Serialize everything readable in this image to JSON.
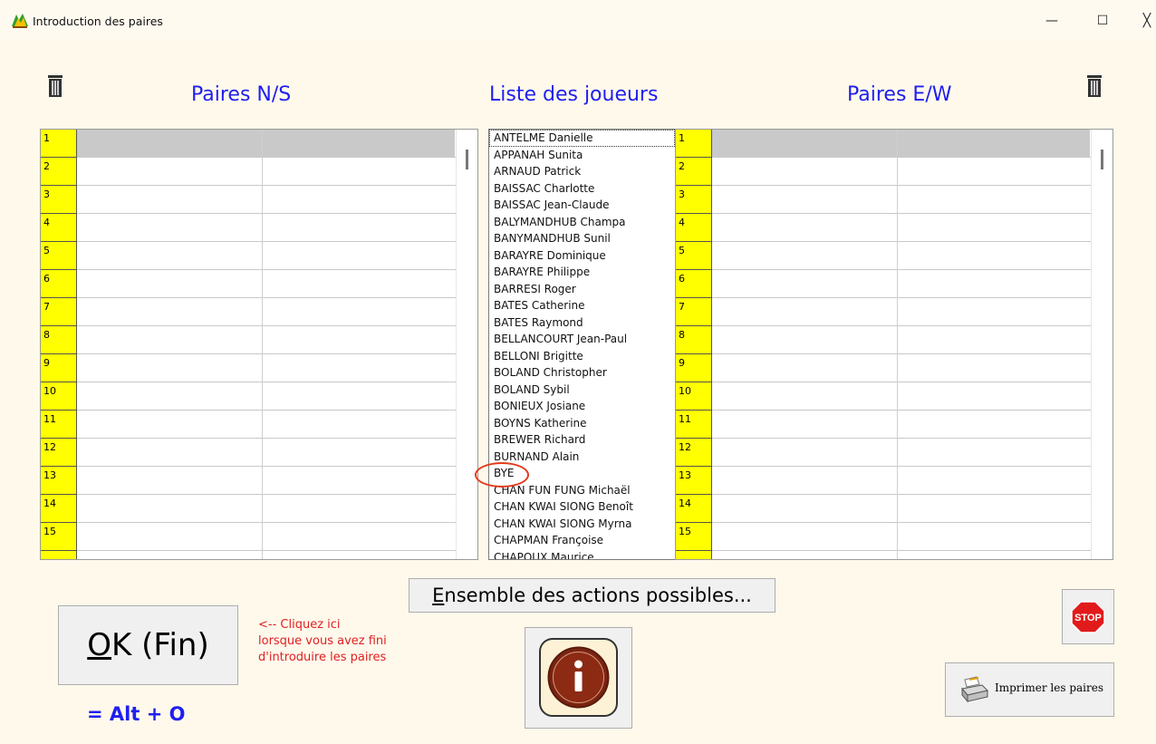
{
  "window": {
    "title": "Introduction des paires",
    "minimize": "—",
    "maximize": "☐",
    "close": "╳"
  },
  "headings": {
    "ns": "Paires N/S",
    "players": "Liste des joueurs",
    "ew": "Paires E/W"
  },
  "pairs_ns": [
    "1",
    "2",
    "3",
    "4",
    "5",
    "6",
    "7",
    "8",
    "9",
    "10",
    "11",
    "12",
    "13",
    "14",
    "15"
  ],
  "pairs_ew": [
    "1",
    "2",
    "3",
    "4",
    "5",
    "6",
    "7",
    "8",
    "9",
    "10",
    "11",
    "12",
    "13",
    "14",
    "15"
  ],
  "players": [
    "ANTELME Danielle",
    "APPANAH Sunita",
    "ARNAUD Patrick",
    "BAISSAC Charlotte",
    "BAISSAC Jean-Claude",
    "BALYMANDHUB Champa",
    "BANYMANDHUB Sunil",
    "BARAYRE Dominique",
    "BARAYRE Philippe",
    "BARRESI Roger",
    "BATES Catherine",
    "BATES Raymond",
    "BELLANCOURT Jean-Paul",
    "BELLONI Brigitte",
    "BOLAND Christopher",
    "BOLAND Sybil",
    "BONIEUX Josiane",
    "BOYNS Katherine",
    "BREWER Richard",
    "BURNAND Alain",
    "BYE",
    "CHAN FUN FUNG Michaël",
    "CHAN KWAI SIONG Benoît",
    "CHAN KWAI SIONG Myrna",
    "CHAPMAN Françoise",
    "CHAPOUX Maurice"
  ],
  "buttons": {
    "actions_mnemonic": "E",
    "actions_rest": "nsemble des actions possibles...",
    "ok_mnemonic": "O",
    "ok_rest": "K (Fin)",
    "print": "Imprimer les paires"
  },
  "hint": [
    "<-- Cliquez ici",
    "lorsque vous avez fini",
    "d'introduire les paires"
  ],
  "shortcut": "= Alt + O",
  "colors": {
    "heading": "#1f1ff0",
    "number_cell": "#ffff00",
    "hint": "#e02020",
    "background": "#fff9ec"
  }
}
